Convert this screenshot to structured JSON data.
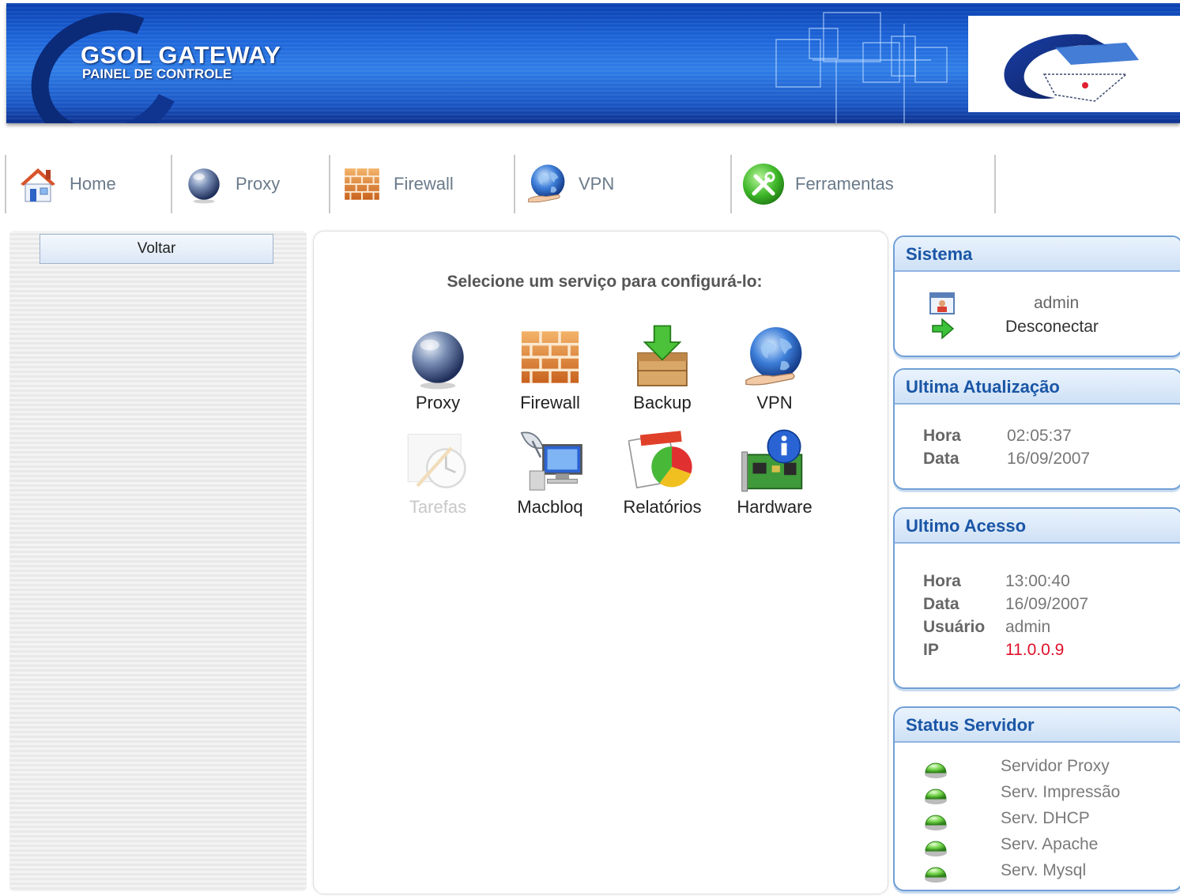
{
  "header": {
    "title": "GSOL GATEWAY",
    "subtitle": "PAINEL DE CONTROLE"
  },
  "nav": {
    "items": [
      {
        "label": "Home",
        "icon": "house-icon"
      },
      {
        "label": "Proxy",
        "icon": "globe-sphere-icon"
      },
      {
        "label": "Firewall",
        "icon": "brick-wall-icon"
      },
      {
        "label": "VPN",
        "icon": "world-globe-icon"
      },
      {
        "label": "Ferramentas",
        "icon": "tools-icon"
      }
    ]
  },
  "sidebar": {
    "back_label": "Voltar"
  },
  "main": {
    "heading": "Selecione um serviço para configurá-lo:",
    "services": [
      {
        "label": "Proxy",
        "icon": "globe-sphere-icon",
        "enabled": true
      },
      {
        "label": "Firewall",
        "icon": "brick-wall-icon",
        "enabled": true
      },
      {
        "label": "Backup",
        "icon": "backup-box-icon",
        "enabled": true
      },
      {
        "label": "VPN",
        "icon": "world-globe-icon",
        "enabled": true
      },
      {
        "label": "Tarefas",
        "icon": "clock-tasks-icon",
        "enabled": false
      },
      {
        "label": "Macbloq",
        "icon": "satellite-monitor-icon",
        "enabled": true
      },
      {
        "label": "Relatórios",
        "icon": "report-chart-icon",
        "enabled": true
      },
      {
        "label": "Hardware",
        "icon": "hardware-info-icon",
        "enabled": true
      }
    ]
  },
  "sistema": {
    "title": "Sistema",
    "user": "admin",
    "logout": "Desconectar"
  },
  "ultima_atualizacao": {
    "title": "Ultima Atualização",
    "hora_label": "Hora",
    "hora": "02:05:37",
    "data_label": "Data",
    "data": "16/09/2007"
  },
  "ultimo_acesso": {
    "title": "Ultimo Acesso",
    "hora_label": "Hora",
    "hora": "13:00:40",
    "data_label": "Data",
    "data": "16/09/2007",
    "usuario_label": "Usuário",
    "usuario": "admin",
    "ip_label": "IP",
    "ip": "11.0.0.9",
    "ip_color": "#e0102a"
  },
  "status_servidor": {
    "title": "Status Servidor",
    "items": [
      {
        "label": "Servidor Proxy",
        "status": "online"
      },
      {
        "label": "Serv. Impressão",
        "status": "online"
      },
      {
        "label": "Serv. DHCP",
        "status": "online"
      },
      {
        "label": "Serv. Apache",
        "status": "online"
      },
      {
        "label": "Serv. Mysql",
        "status": "online"
      }
    ],
    "online_color": "#5cc23a"
  },
  "colors": {
    "banner_blue": "#1c63d8",
    "panel_title": "#1a56a6",
    "panel_border": "#6f9fd6"
  }
}
